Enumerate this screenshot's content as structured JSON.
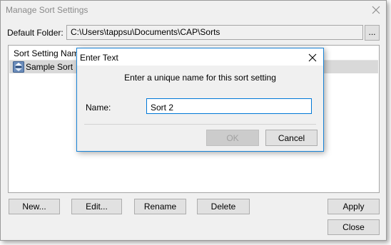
{
  "window": {
    "title": "Manage Sort Settings",
    "close_glyph": "✕"
  },
  "folder": {
    "label": "Default Folder:",
    "path": "C:\\Users\\tappsu\\Documents\\CAP\\Sorts",
    "browse_label": "..."
  },
  "list": {
    "column_header": "Sort Setting Name",
    "rows": [
      {
        "label": "Sample Sort",
        "icon": "sort-setting-icon"
      }
    ]
  },
  "buttons": {
    "new": "New...",
    "edit": "Edit...",
    "rename": "Rename",
    "delete": "Delete",
    "apply": "Apply",
    "close": "Close"
  },
  "dialog": {
    "title": "Enter Text",
    "close_glyph": "✕",
    "prompt": "Enter a unique name for this sort setting",
    "name_label": "Name:",
    "name_value": "Sort 2",
    "ok_label": "OK",
    "cancel_label": "Cancel"
  },
  "colors": {
    "dialog_border": "#1883d7",
    "input_focus": "#0078d7",
    "selected_row": "#d9d9d9"
  }
}
